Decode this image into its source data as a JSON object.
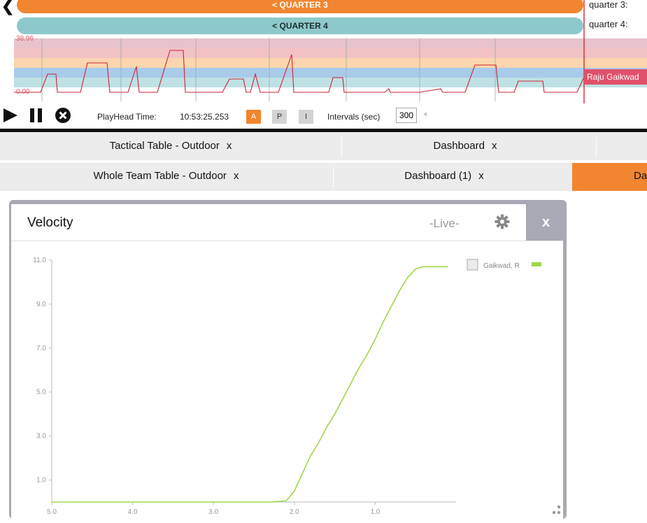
{
  "timeline": {
    "quarter3_bar": "< QUARTER 3",
    "quarter4_bar": "< QUARTER 4",
    "quarter3_label": "quarter 3:",
    "quarter4_label": "quarter 4:",
    "y_max": "38.96",
    "y_min": "0.00",
    "player_tag": "Raju Gaikwad",
    "band_colors": [
      "#e9c3cc",
      "#f2c2c5",
      "#fbd6ae",
      "#a9cbea",
      "#bfe1e3"
    ],
    "line_color": "#cc2233"
  },
  "controls": {
    "playhead_label": "PlayHead Time:",
    "playhead_time": "10:53:25.253",
    "btn_a": "A",
    "btn_p": "P",
    "btn_i": "I",
    "intervals_label": "Intervals (sec)",
    "intervals_value": "300"
  },
  "tabs": {
    "row1": [
      {
        "label": "Tactical Table - Outdoor",
        "close": "x"
      },
      {
        "label": "Dashboard",
        "close": "x"
      },
      {
        "label": "",
        "close": ""
      }
    ],
    "row2": [
      {
        "label": "Whole Team Table - Outdoor",
        "close": "x"
      },
      {
        "label": "Dashboard (1)",
        "close": "x"
      },
      {
        "label": "Da",
        "close": ""
      }
    ],
    "active_color": "#f28530"
  },
  "widget": {
    "title": "Velocity",
    "status": "-Live-",
    "close": "x"
  },
  "chart_data": {
    "type": "line",
    "title": "",
    "xlabel": "",
    "ylabel": "",
    "xlim": [
      5.0,
      0.0
    ],
    "ylim": [
      0.0,
      11.0
    ],
    "x_ticks": [
      "5.0",
      "4.0",
      "3.0",
      "2.0",
      "1.0"
    ],
    "y_ticks": [
      "11.0",
      "9.0",
      "7.0",
      "5.0",
      "3.0",
      "1.0"
    ],
    "legend": {
      "position": "top-right"
    },
    "series": [
      {
        "name": "Gaikwad, R",
        "color": "#9fd84a",
        "x": [
          5.0,
          4.0,
          3.0,
          2.3,
          2.1,
          2.0,
          1.9,
          1.8,
          1.7,
          1.6,
          1.5,
          1.4,
          1.3,
          1.2,
          1.1,
          1.0,
          0.9,
          0.8,
          0.7,
          0.6,
          0.5,
          0.4,
          0.3,
          0.2,
          0.1
        ],
        "y": [
          0.0,
          0.0,
          0.0,
          0.0,
          0.05,
          0.5,
          1.3,
          2.1,
          2.7,
          3.4,
          4.0,
          4.7,
          5.4,
          6.1,
          6.7,
          7.4,
          8.2,
          8.9,
          9.6,
          10.2,
          10.6,
          10.7,
          10.7,
          10.7,
          10.7
        ]
      }
    ]
  }
}
